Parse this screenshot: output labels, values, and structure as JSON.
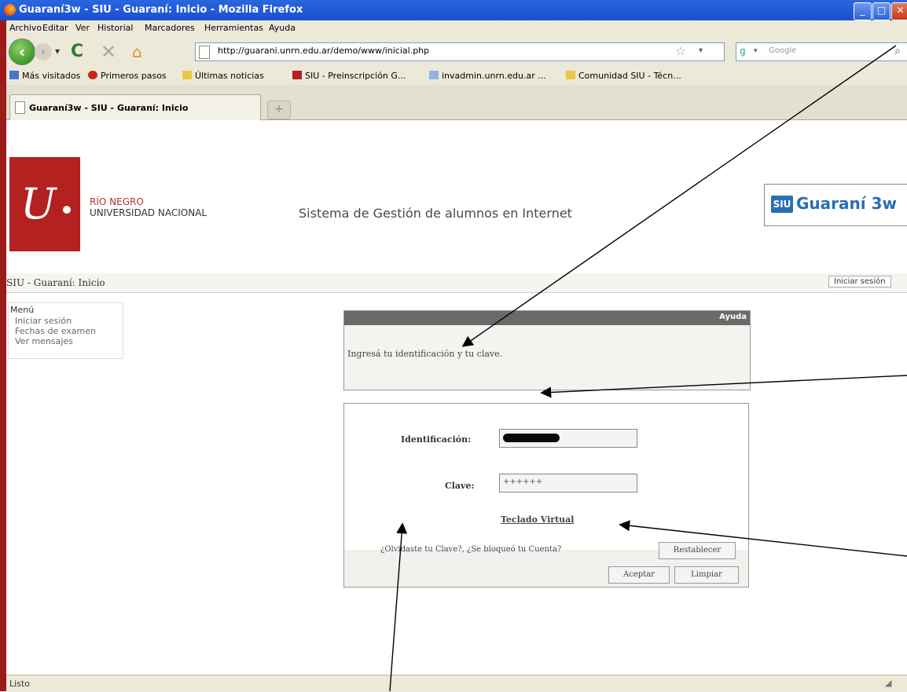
{
  "window": {
    "title": "Guaraní3w - SIU - Guaraní: Inicio - Mozilla Firefox"
  },
  "menubar": [
    "Archivo",
    "Editar",
    "Ver",
    "Historial",
    "Marcadores",
    "Herramientas",
    "Ayuda"
  ],
  "nav": {
    "url": "http://guarani.unrn.edu.ar/demo/www/inicial.php",
    "search_placeholder": "Google"
  },
  "bookmarks": [
    "Más visitados",
    "Primeros pasos",
    "Últimas noticias",
    "SIU - Preinscripción G...",
    "invadmin.unrn.edu.ar ...",
    "Comunidad SIU - Técn..."
  ],
  "tab": {
    "label": "Guaraní3w - SIU - Guaraní: Inicio"
  },
  "header": {
    "university_line1": "RÍO NEGRO",
    "university_line2": "UNIVERSIDAD NACIONAL",
    "system_title": "Sistema de Gestión de alumnos en Internet",
    "siu_badge": "SIU",
    "siu_product": "Guaraní 3w"
  },
  "breadcrumb": "SIU - Guaraní: Inicio",
  "login_link": "Iniciar sesión",
  "menu": {
    "title": "Menú",
    "items": [
      "Iniciar sesión",
      "Fechas de examen",
      "Ver mensajes"
    ]
  },
  "help": {
    "title": "Ayuda",
    "message": "Ingresá tu identificación y tu clave."
  },
  "form": {
    "id_label": "Identificación:",
    "clave_label": "Clave:",
    "clave_value": "++++++",
    "virtual_keyboard": "Teclado Virtual",
    "forgot_text": "¿Olvidaste tu Clave?, ¿Se bloqueó tu Cuenta?",
    "reset_button": "Restablecer",
    "accept_button": "Aceptar",
    "clear_button": "Limpiar"
  },
  "status": {
    "text": "Listo"
  },
  "colors": {
    "titlebar": "#1a4fd0",
    "university_red": "#b32121",
    "siu_blue": "#2a6fb0"
  }
}
